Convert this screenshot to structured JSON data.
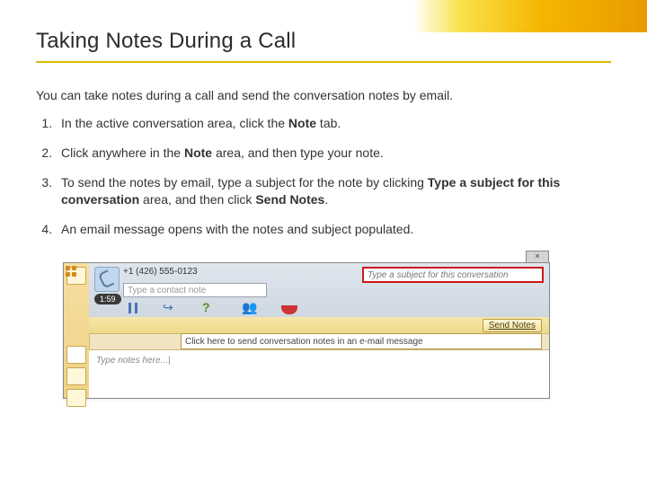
{
  "title": "Taking Notes During a Call",
  "intro": "You can take notes during a call and send the conversation notes by email.",
  "steps": [
    {
      "pre": "In the active conversation area, click the ",
      "b1": "Note",
      "post": " tab."
    },
    {
      "pre": "Click anywhere in the ",
      "b1": "Note",
      "post": " area, and then type your note."
    },
    {
      "pre": "To send the notes by email, type a subject for the note by clicking ",
      "b1": "Type a subject for this conversation",
      "mid": " area, and then click ",
      "b2": "Send Notes",
      "post": "."
    },
    {
      "pre": "An email message opens with the notes and subject populated.",
      "b1": "",
      "post": ""
    }
  ],
  "mock": {
    "phone": "+1 (426) 555-0123",
    "timer": "1:59",
    "contact_ph": "Type a contact note",
    "subject_ph": "Type a subject for this conversation",
    "send": "Send Notes",
    "hint": "Click here to send conversation notes in an e-mail message",
    "notes_ph": "Type notes here...|",
    "close": "×"
  }
}
